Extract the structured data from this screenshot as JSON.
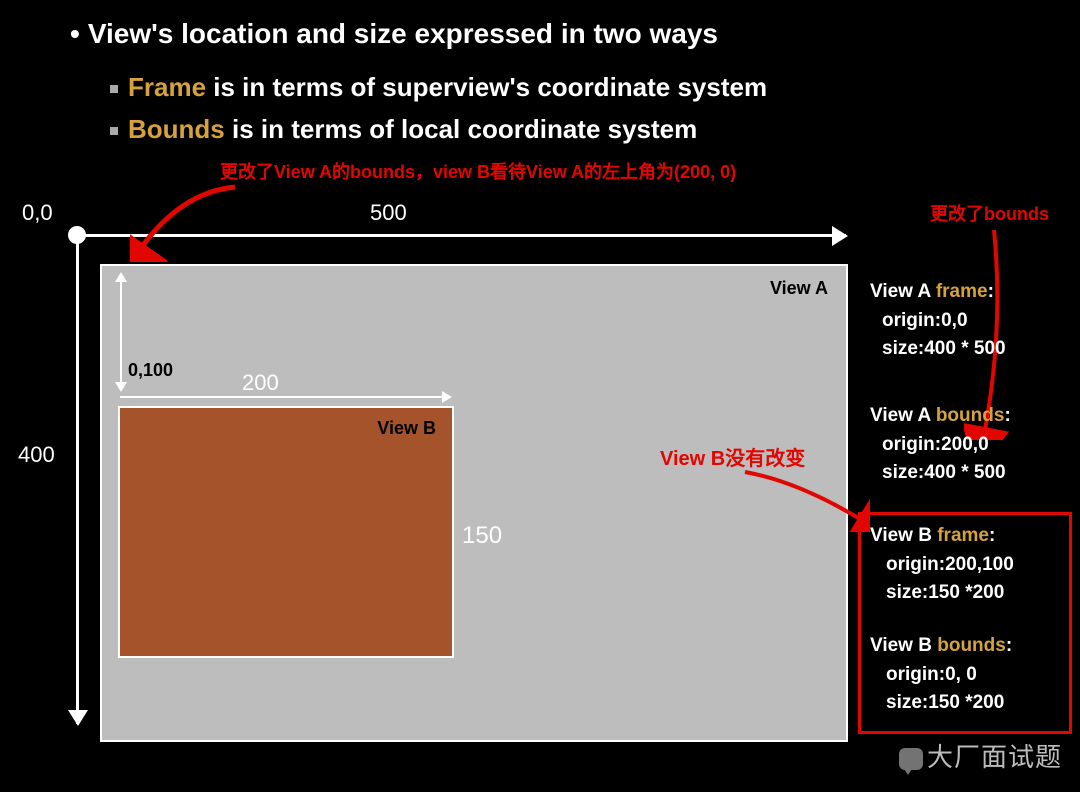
{
  "bullets": {
    "main": "View's location and size expressed in two ways",
    "frame_word": "Frame",
    "frame_rest": " is in terms of superview's coordinate system",
    "bounds_word": "Bounds",
    "bounds_rest": " is in terms of local coordinate system"
  },
  "annotations": {
    "top_red": "更改了View A的bounds，view B看待View A的左上角为(200, 0)",
    "right_red": "更改了bounds",
    "viewb_red": "View B没有改变"
  },
  "axes": {
    "origin": "0,0",
    "x_extent": "500",
    "y_extent": "400"
  },
  "viewA": {
    "label": "View A",
    "inner_point": "0,100",
    "horiz_len": "200",
    "vert_len": "150"
  },
  "viewB": {
    "label": "View B"
  },
  "panel": {
    "a_frame_title_pre": "View A ",
    "a_frame_title_key": "frame",
    "a_frame_origin": "origin:0,0",
    "a_frame_size": "size:400 * 500",
    "a_bounds_title_pre": "View A ",
    "a_bounds_title_key": "bounds",
    "a_bounds_origin": "origin:200,0",
    "a_bounds_size": "size:400 * 500",
    "b_frame_title_pre": "View B ",
    "b_frame_title_key": "frame",
    "b_frame_origin": "origin:200,100",
    "b_frame_size": "size:150 *200",
    "b_bounds_title_pre": "View B ",
    "b_bounds_title_key": "bounds",
    "b_bounds_origin": "origin:0, 0",
    "b_bounds_size": "size:150 *200"
  },
  "watermark": "大厂面试题",
  "chart_data": {
    "type": "diagram",
    "title": "View's location and size expressed in two ways",
    "coordinate_system": {
      "origin": [
        0,
        0
      ],
      "x_max": 500,
      "y_max": 400
    },
    "views": [
      {
        "name": "View A",
        "frame": {
          "origin": [
            0,
            0
          ],
          "size": [
            400,
            500
          ]
        },
        "bounds": {
          "origin": [
            200,
            0
          ],
          "size": [
            400,
            500
          ]
        }
      },
      {
        "name": "View B",
        "frame": {
          "origin": [
            200,
            100
          ],
          "size": [
            150,
            200
          ]
        },
        "bounds": {
          "origin": [
            0,
            0
          ],
          "size": [
            150,
            200
          ]
        }
      }
    ],
    "inner_arrows": {
      "from_viewA_origin_to_point": [
        0,
        100
      ],
      "horizontal_span_label": 200,
      "vertical_span_label": 150
    },
    "annotations": [
      "更改了View A的bounds，view B看待View A的左上角为(200, 0)",
      "更改了bounds",
      "View B没有改变"
    ]
  }
}
